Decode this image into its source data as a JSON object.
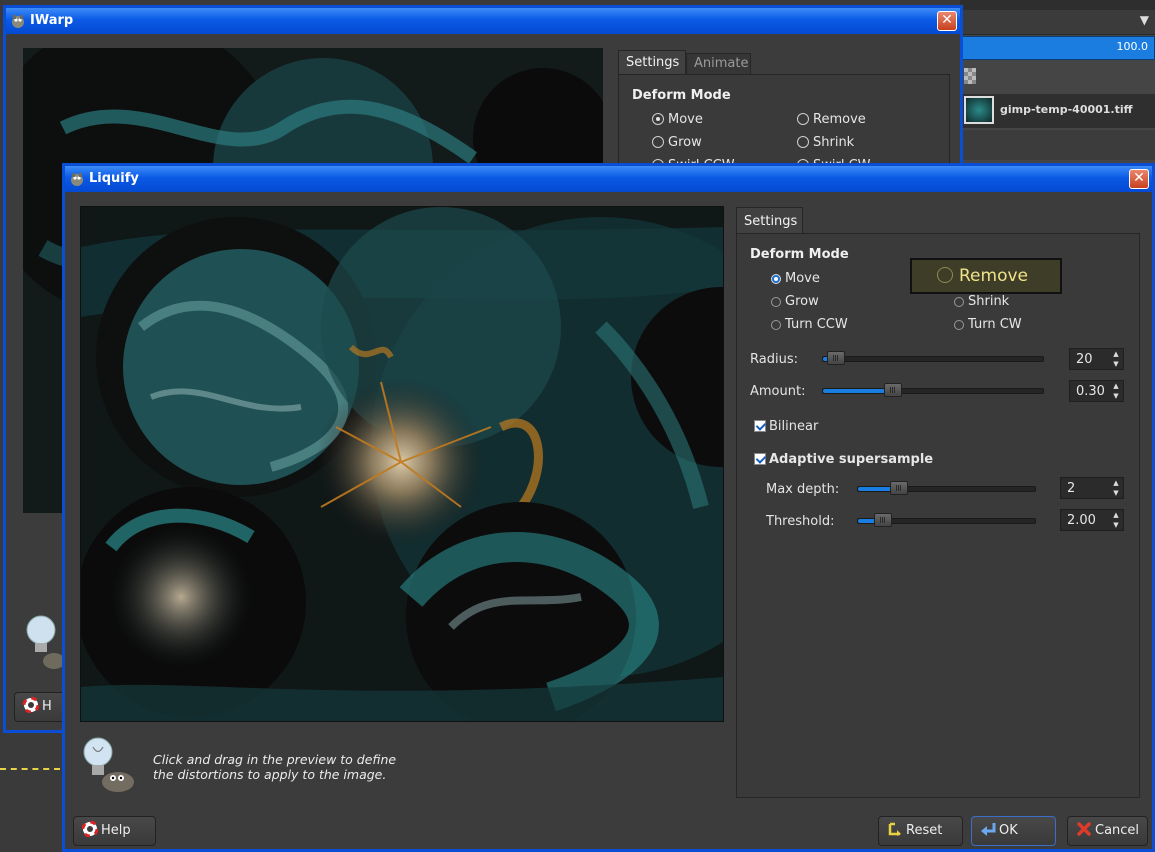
{
  "background_panel": {
    "opacity_value": "100.0",
    "layer_name": "gimp-temp-40001.tiff"
  },
  "iwarp": {
    "title": "IWarp",
    "close_glyph": "✕",
    "tabs": [
      {
        "label": "Settings"
      },
      {
        "label": "Animate"
      }
    ],
    "deform_mode_title": "Deform Mode",
    "modes": [
      "Move",
      "Remove",
      "Grow",
      "Shrink",
      "Swirl CCW",
      "Swirl CW"
    ],
    "help_label": "H"
  },
  "liquify": {
    "title": "Liquify",
    "close_glyph": "✕",
    "tab": "Settings",
    "deform_mode_title": "Deform Mode",
    "modes": [
      "Move",
      "Remove",
      "Grow",
      "Shrink",
      "Turn CCW",
      "Turn CW"
    ],
    "hover_label": "Remove",
    "radius_label": "Radius:",
    "radius_value": "20",
    "amount_label": "Amount:",
    "amount_value": "0.30",
    "bilinear_label": "Bilinear",
    "adaptive_label": "Adaptive supersample",
    "max_depth_label": "Max depth:",
    "max_depth_value": "2",
    "threshold_label": "Threshold:",
    "threshold_value": "2.00",
    "hint_line1": "Click and drag in the preview to define",
    "hint_line2": "the distortions to apply to the image.",
    "buttons": {
      "help": "Help",
      "reset": "Reset",
      "ok": "OK",
      "cancel": "Cancel"
    },
    "slider_levels": {
      "radius": 0.02,
      "amount": 0.3,
      "max_depth": 0.2,
      "threshold": 0.1
    }
  },
  "colors": {
    "titlebar": "#0b5ae6",
    "accent": "#1a7ee0",
    "tooltip_text": "#f1e38a"
  },
  "icons": [
    "gimp-logo-icon",
    "close-icon",
    "lifebuoy-help-icon",
    "reset-arrow-icon",
    "ok-arrow-icon",
    "cancel-x-icon",
    "wilber-lightbulb-icon"
  ]
}
